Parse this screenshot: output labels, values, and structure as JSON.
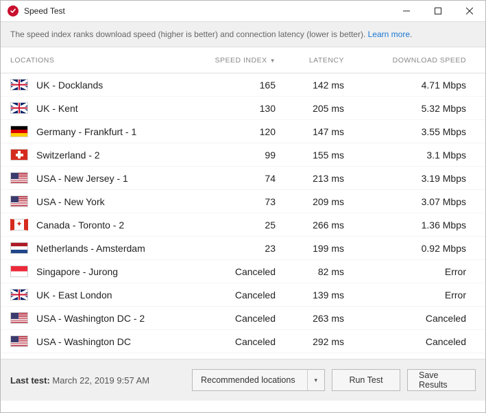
{
  "window": {
    "title": "Speed Test"
  },
  "infobar": {
    "text": "The speed index ranks download speed (higher is better) and connection latency (lower is better). ",
    "link_text": "Learn more"
  },
  "columns": {
    "locations": "LOCATIONS",
    "speed_index": "SPEED INDEX",
    "latency": "LATENCY",
    "download_speed": "DOWNLOAD SPEED"
  },
  "rows": [
    {
      "flag": "uk",
      "location": "UK - Docklands",
      "speed_index": "165",
      "latency": "142 ms",
      "download": "4.71 Mbps"
    },
    {
      "flag": "uk",
      "location": "UK - Kent",
      "speed_index": "130",
      "latency": "205 ms",
      "download": "5.32 Mbps"
    },
    {
      "flag": "de",
      "location": "Germany - Frankfurt - 1",
      "speed_index": "120",
      "latency": "147 ms",
      "download": "3.55 Mbps"
    },
    {
      "flag": "ch",
      "location": "Switzerland - 2",
      "speed_index": "99",
      "latency": "155 ms",
      "download": "3.1 Mbps"
    },
    {
      "flag": "us",
      "location": "USA - New Jersey - 1",
      "speed_index": "74",
      "latency": "213 ms",
      "download": "3.19 Mbps"
    },
    {
      "flag": "us",
      "location": "USA - New York",
      "speed_index": "73",
      "latency": "209 ms",
      "download": "3.07 Mbps"
    },
    {
      "flag": "ca",
      "location": "Canada - Toronto - 2",
      "speed_index": "25",
      "latency": "266 ms",
      "download": "1.36 Mbps"
    },
    {
      "flag": "nl",
      "location": "Netherlands - Amsterdam",
      "speed_index": "23",
      "latency": "199 ms",
      "download": "0.92 Mbps"
    },
    {
      "flag": "sg",
      "location": "Singapore - Jurong",
      "speed_index": "Canceled",
      "latency": "82 ms",
      "download": "Error"
    },
    {
      "flag": "uk",
      "location": "UK - East London",
      "speed_index": "Canceled",
      "latency": "139 ms",
      "download": "Error"
    },
    {
      "flag": "us",
      "location": "USA - Washington DC - 2",
      "speed_index": "Canceled",
      "latency": "263 ms",
      "download": "Canceled"
    },
    {
      "flag": "us",
      "location": "USA - Washington DC",
      "speed_index": "Canceled",
      "latency": "292 ms",
      "download": "Canceled"
    }
  ],
  "footer": {
    "last_test_label": "Last test:",
    "last_test_value": "March 22, 2019 9:57 AM",
    "select_label": "Recommended locations",
    "run_test": "Run Test",
    "save_results": "Save Results"
  }
}
